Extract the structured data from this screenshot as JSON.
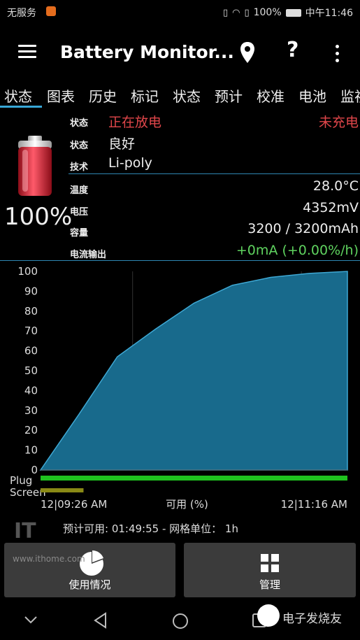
{
  "status_bar": {
    "carrier": "无服务",
    "battery": "100%",
    "time": "中午11:46"
  },
  "app": {
    "title": "Battery Monitor..."
  },
  "tabs": [
    "状态",
    "图表",
    "历史",
    "标记",
    "状态",
    "预计",
    "校准",
    "电池",
    "监视"
  ],
  "battery": {
    "percent": "100%"
  },
  "info": {
    "status_label": "状态",
    "status_value": "正在放电",
    "plug_value": "未充电",
    "health_label": "状态",
    "health_value": "良好",
    "tech_label": "技术",
    "tech_value": "Li-poly",
    "temp_label": "温度",
    "temp_value": "28.0°C",
    "voltage_label": "电压",
    "voltage_value": "4352mV",
    "capacity_label": "容量",
    "capacity_value": "3200 / 3200mAh",
    "current_label": "电流输出",
    "current_value": "+0mA (+0.00%/h)"
  },
  "colors": {
    "accent": "#37a7d6",
    "discharging": "#e0464a",
    "current": "#5fd35f",
    "area_fill": "#186a8c",
    "plug_bar": "#1fc21f",
    "screen_bar": "#8a8a16"
  },
  "chart_data": {
    "type": "area",
    "x": [
      "09:26",
      "09:41",
      "09:56",
      "10:11",
      "10:26",
      "10:41",
      "10:56",
      "11:06",
      "11:16"
    ],
    "values": [
      0,
      28,
      57,
      71,
      84,
      93,
      97,
      99,
      100
    ],
    "ylim": [
      0,
      100
    ],
    "yticks": [
      "100",
      "90",
      "80",
      "70",
      "60",
      "50",
      "40",
      "30",
      "20",
      "10",
      "0"
    ],
    "xlabel": "可用 (%)",
    "x_start_label": "12|09:26 AM",
    "x_end_label": "12|11:16 AM",
    "row_labels": [
      "Plug",
      "Screen"
    ],
    "plug_fraction": 1.0,
    "screen_fraction": 0.14
  },
  "predict_text": "预计可用: 01:49:55 - 网格单位： 1h",
  "buttons": {
    "usage": "使用情况",
    "manage": "管理"
  },
  "watermarks": {
    "ithome": "www.ithome.com",
    "elecfans": "电子发烧友"
  },
  "icons": [
    "menu-icon",
    "location-pin-icon",
    "help-icon",
    "more-icon",
    "pie-chart-icon",
    "grid-icon",
    "back-icon",
    "home-icon",
    "recents-icon",
    "battery-icon"
  ]
}
